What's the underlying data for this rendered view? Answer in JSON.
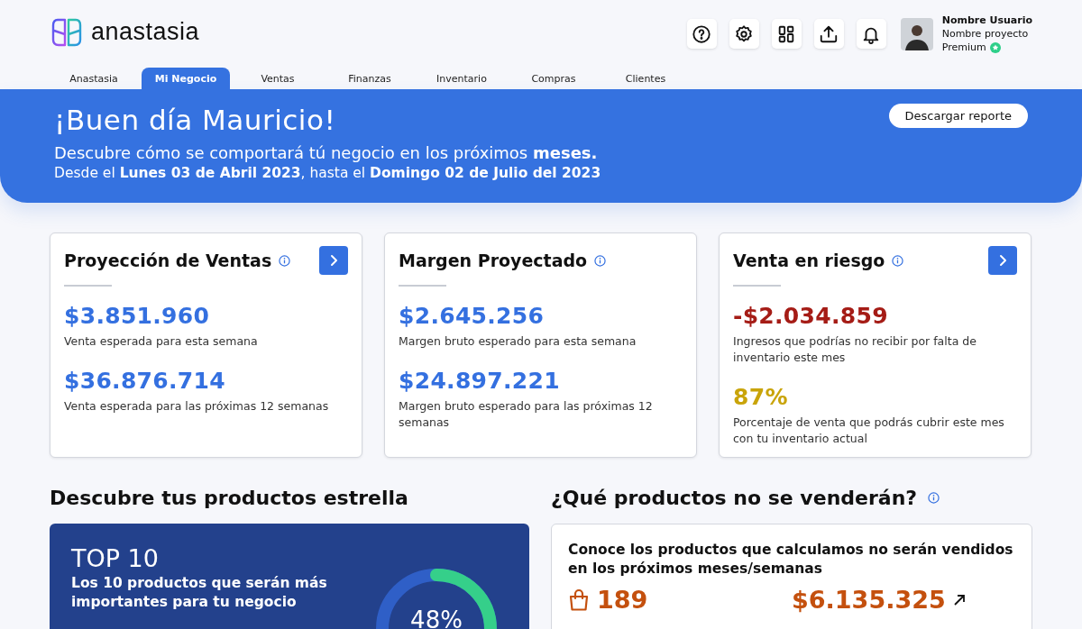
{
  "brand": "anastasia",
  "toolbar": [
    {
      "kind": "help"
    },
    {
      "kind": "settings"
    },
    {
      "kind": "dashboard"
    },
    {
      "kind": "upload"
    },
    {
      "kind": "bell"
    }
  ],
  "user": {
    "name": "Nombre Usuario",
    "project": "Nombre proyecto",
    "plan": "Premium"
  },
  "tabs": [
    {
      "label": "Anastasia",
      "selected": false
    },
    {
      "label": "Mi Negocio",
      "selected": true
    },
    {
      "label": "Ventas",
      "selected": false
    },
    {
      "label": "Finanzas",
      "selected": false
    },
    {
      "label": "Inventario",
      "selected": false
    },
    {
      "label": "Compras",
      "selected": false
    },
    {
      "label": "Clientes",
      "selected": false
    }
  ],
  "banner": {
    "greeting": "¡Buen día Mauricio!",
    "subtitle": "Descubre cómo se comportará tú negocio en los próximos **meses.**",
    "range": "Desde el **Lunes 03 de Abril 2023**, hasta el **Domingo 02 de Julio del 2023**",
    "button": "Descargar reporte"
  },
  "cards": [
    {
      "title": "Proyección de Ventas",
      "has_arrow": true,
      "metrics": [
        {
          "value": "$3.851.960",
          "color": "#3470e0",
          "caption": "Venta esperada para esta semana"
        },
        {
          "value": "$36.876.714",
          "color": "#3470e0",
          "caption": "Venta esperada para las próximas 12 semanas"
        }
      ]
    },
    {
      "title": "Margen Proyectado",
      "has_arrow": false,
      "metrics": [
        {
          "value": "$2.645.256",
          "color": "#3470e0",
          "caption": "Margen bruto esperado para esta semana"
        },
        {
          "value": "$24.897.221",
          "color": "#3470e0",
          "caption": "Margen bruto esperado para las próximas 12 semanas"
        }
      ]
    },
    {
      "title": "Venta en riesgo",
      "has_arrow": true,
      "metrics": [
        {
          "value": "-$2.034.859",
          "color": "#a51c16",
          "caption": "Ingresos que podrías no recibir por falta de inventario este mes"
        },
        {
          "value": "87%",
          "color": "#c9a40a",
          "caption": "Porcentaje de venta que podrás cubrir este mes con tu inventario actual"
        }
      ]
    }
  ],
  "star_products": {
    "heading": "Descubre tus productos estrella",
    "title": "TOP 10",
    "text": "Los 10 productos que serán más importantes para tu negocio",
    "level": 0.3,
    "percent": "48%"
  },
  "unsold": {
    "heading": "¿Qué productos no se venderán?",
    "text": "Conoce los productos que calculamos no serán vendidos en los próximos meses/semanas",
    "count": "189",
    "amount": "$6.135.325"
  }
}
